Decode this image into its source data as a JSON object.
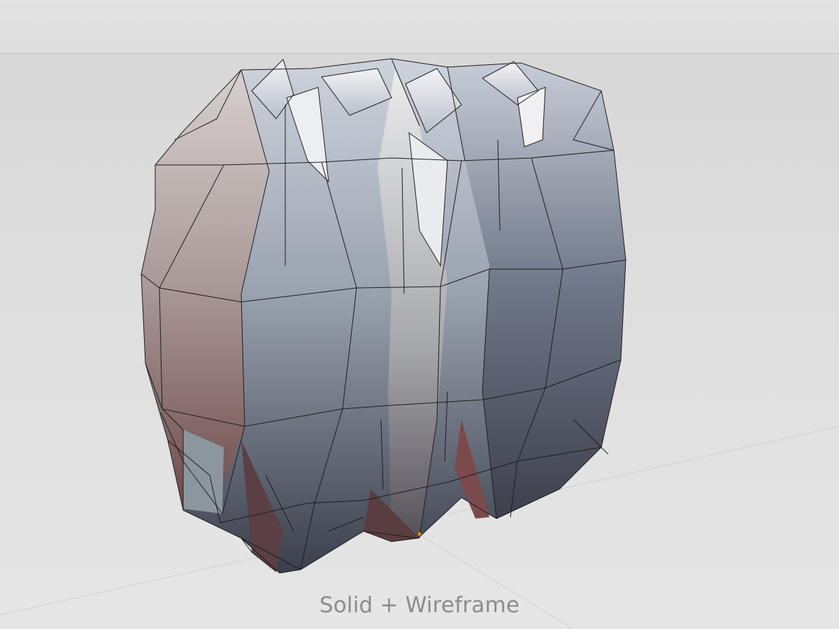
{
  "viewport": {
    "shading_mode_label": "Solid + Wireframe"
  },
  "colors": {
    "background": "#dcdcdc",
    "mesh_light": "#c9ced6",
    "mesh_dark": "#3f4452",
    "mesh_warm": "#7c5a58",
    "wire": "#1a1a1a",
    "origin_point": "#f08a1a"
  },
  "icons": {
    "origin": "origin-point-icon"
  }
}
